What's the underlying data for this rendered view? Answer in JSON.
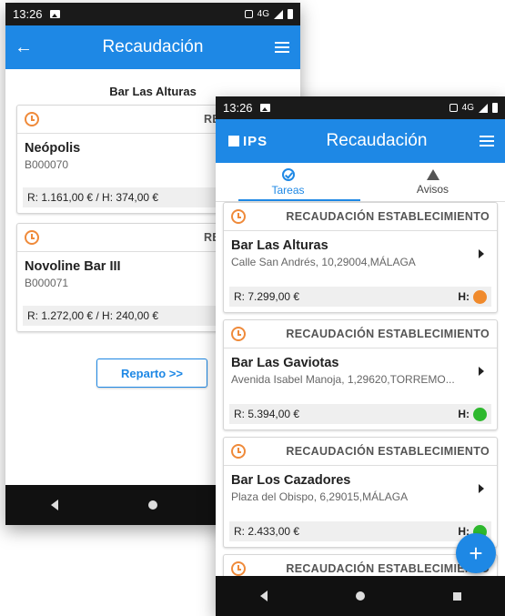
{
  "back_phone": {
    "status_time": "13:26",
    "status_network": "4G",
    "app_title": "Recaudación",
    "section_title": "Bar Las Alturas",
    "cards": [
      {
        "type": "RECAUDACIÓN",
        "name": "Neópolis",
        "code": "B000070",
        "footer": "R: 1.161,00 € / H: 374,00 €"
      },
      {
        "type": "RECAUDACIÓN",
        "name": "Novoline Bar III",
        "code": "B000071",
        "footer": "R: 1.272,00 € / H: 240,00 €"
      }
    ],
    "button_label": "Reparto >>"
  },
  "front_phone": {
    "status_time": "13:26",
    "status_network": "4G",
    "logo_text": "IPS",
    "app_title": "Recaudación",
    "tabs": [
      {
        "label": "Tareas",
        "icon": "check-circle-icon",
        "active": true
      },
      {
        "label": "Avisos",
        "icon": "warning-icon",
        "active": false
      }
    ],
    "cards": [
      {
        "type": "RECAUDACIÓN ESTABLECIMIENTO",
        "name": "Bar Las Alturas",
        "address": "Calle San Andrés, 10,29004,MÁLAGA",
        "r_value": "R: 7.299,00 €",
        "h_label": "H:",
        "h_color": "#f08a2c"
      },
      {
        "type": "RECAUDACIÓN ESTABLECIMIENTO",
        "name": "Bar Las Gaviotas",
        "address": "Avenida Isabel Manoja, 1,29620,TORREMO...",
        "r_value": "R: 5.394,00 €",
        "h_label": "H:",
        "h_color": "#2eb82e"
      },
      {
        "type": "RECAUDACIÓN ESTABLECIMIENTO",
        "name": "Bar Los Cazadores",
        "address": "Plaza del Obispo, 6,29015,MÁLAGA",
        "r_value": "R: 2.433,00 €",
        "h_label": "H:",
        "h_color": "#2eb82e"
      },
      {
        "type": "RECAUDACIÓN ESTABLECIMIENTO"
      }
    ],
    "fab_label": "+"
  },
  "colors": {
    "primary": "#1e88e5",
    "accent_orange": "#ef8a3a"
  }
}
